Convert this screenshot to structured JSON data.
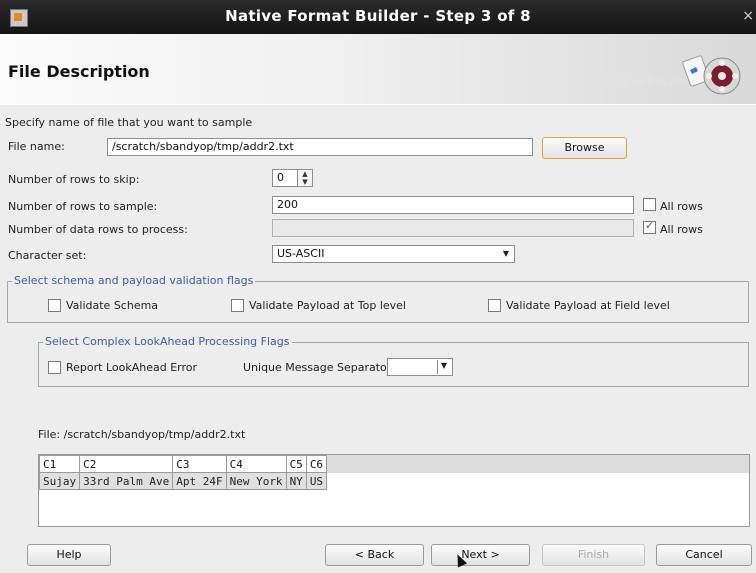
{
  "window": {
    "title": "Native Format Builder - Step 3 of 8",
    "close_glyph": "×"
  },
  "header": {
    "title": "File Description",
    "watermark": "ORACLE FUSION MIDDLEWARE"
  },
  "form": {
    "intro": "Specify name of file that you want to sample",
    "file_name_label": "File name:",
    "file_name_value": "/scratch/sbandyop/tmp/addr2.txt",
    "browse_label": "Browse",
    "rows_to_skip_label": "Number of rows to skip:",
    "rows_to_skip_value": "0",
    "rows_to_sample_label": "Number of rows to sample:",
    "rows_to_sample_value": "200",
    "all_rows_sample_label": "All rows",
    "all_rows_sample_checked": false,
    "data_rows_label": "Number of data rows to process:",
    "data_rows_value": "",
    "all_rows_data_label": "All rows",
    "all_rows_data_checked": true,
    "charset_label": "Character set:",
    "charset_value": "US-ASCII"
  },
  "validation_group": {
    "legend": "Select schema and payload validation flags",
    "validate_schema": "Validate Schema",
    "validate_payload_top": "Validate Payload at Top level",
    "validate_payload_field": "Validate Payload at Field level"
  },
  "lookahead_group": {
    "legend": "Select Complex LookAhead Processing Flags",
    "report_error": "Report LookAhead Error",
    "separator_label": "Unique Message Separator",
    "separator_value": ""
  },
  "preview": {
    "file_label": "File: /scratch/sbandyop/tmp/addr2.txt",
    "columns": [
      "C1",
      "C2",
      "C3",
      "C4",
      "C5",
      "C6"
    ],
    "rows": [
      [
        "Sujay",
        "33rd Palm Ave",
        "Apt 24F",
        "New York",
        "NY",
        "US"
      ]
    ]
  },
  "footer": {
    "help": "Help",
    "back": "< Back",
    "next": "Next >",
    "finish": "Finish",
    "cancel": "Cancel"
  },
  "colors": {
    "accent": "#e3a23a",
    "legend_text": "#3d5f9a",
    "titlebar": "#1e1e1e"
  }
}
